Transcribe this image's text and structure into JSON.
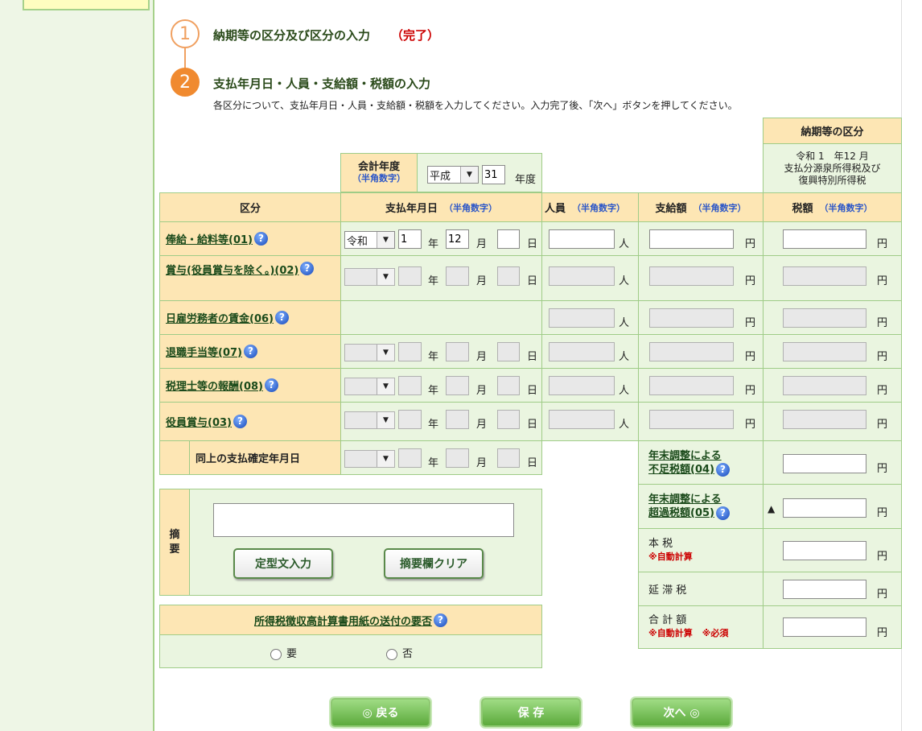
{
  "steps": {
    "step1": {
      "number": "1",
      "title": "納期等の区分及び区分の入力",
      "status": "（完了）"
    },
    "step2": {
      "number": "2",
      "title": "支払年月日・人員・支給額・税額の入力",
      "instruction": "各区分について、支払年月日・人員・支給額・税額を入力してください。入力完了後、「次へ」ボタンを押してください。"
    }
  },
  "noki": {
    "header": "納期等の区分",
    "line1": "令和 1　年12 月",
    "line2": "支払分源泉所得税及び",
    "line3": "復興特別所得税"
  },
  "fiscal": {
    "label": "会計年度",
    "note": "（半角数字）",
    "era": "平成",
    "year": "31",
    "unit": "年度"
  },
  "headers": {
    "kubun": "区分",
    "date": "支払年月日",
    "people": "人員",
    "amount": "支給額",
    "tax": "税額",
    "half": "（半角数字）"
  },
  "units": {
    "year": "年",
    "month": "月",
    "day": "日",
    "person": "人",
    "yen": "円"
  },
  "help_icon": "?",
  "rows": [
    {
      "label": "俸給・給料等(01)",
      "era": "令和",
      "year": "1",
      "month": "12",
      "day": "",
      "enabled": true
    },
    {
      "label": "賞与(役員賞与を除く。)(02)",
      "era": "",
      "year": "",
      "month": "",
      "day": "",
      "enabled": false
    },
    {
      "label": "日雇労務者の賃金(06)",
      "enabled": false
    },
    {
      "label": "退職手当等(07)",
      "era": "",
      "year": "",
      "month": "",
      "day": "",
      "enabled": false
    },
    {
      "label": "税理士等の報酬(08)",
      "era": "",
      "year": "",
      "month": "",
      "day": "",
      "enabled": false
    },
    {
      "label": "役員賞与(03)",
      "era": "",
      "year": "",
      "month": "",
      "day": "",
      "enabled": false
    }
  ],
  "confirm_row": {
    "label": "同上の支払確定年月日"
  },
  "adjust": {
    "shortage_l1": "年末調整による",
    "shortage_l2": "不足税額(04)",
    "excess_l1": "年末調整による",
    "excess_l2": "超過税額(05)",
    "triangle": "▲"
  },
  "totals": {
    "honzei": "本 税",
    "auto": "※自動計算",
    "entai": "延 滞 税",
    "gokei": "合 計 額",
    "required": "※必須"
  },
  "tekiyo": {
    "label_1": "摘",
    "label_2": "要",
    "value": "",
    "btn_template": "定型文入力",
    "btn_clear": "摘要欄クリア"
  },
  "sending": {
    "label": "所得税徴収高計算書用紙の送付の要否",
    "yes": "要",
    "no": "否"
  },
  "nav": {
    "back": "◎ 戻る",
    "save": "保 存",
    "next": "次へ ◎"
  }
}
